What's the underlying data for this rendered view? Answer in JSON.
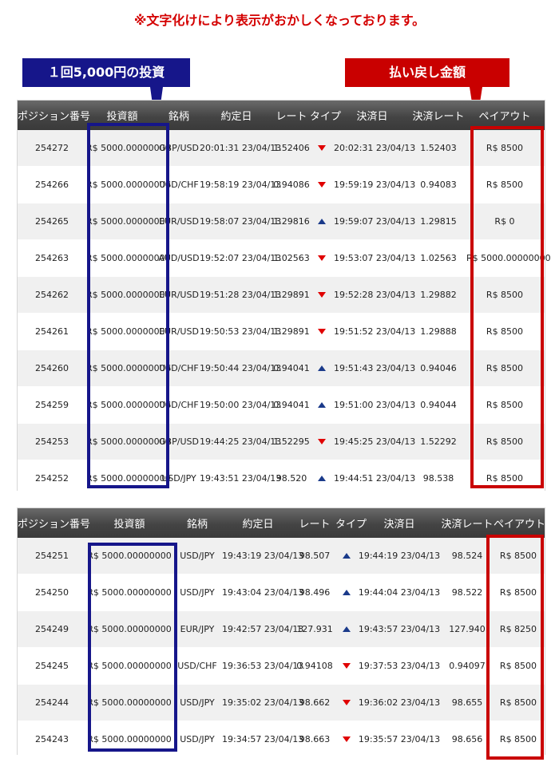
{
  "notice": "※文字化けにより表示がおかしくなっております。",
  "callouts": {
    "investment": "１回5,000円の投資",
    "payout": "払い戻し金額"
  },
  "columns": [
    "ポジション番号",
    "投資額",
    "銘柄",
    "約定日",
    "レート",
    "タイプ",
    "決済日",
    "決済レート",
    "ペイアウト"
  ],
  "colors": {
    "accent_blue": "#16168a",
    "accent_red": "#c90000",
    "down": "#e00000",
    "up": "#1a3a8a"
  },
  "table1": [
    {
      "id": "254272",
      "amount": "R$ 5000.00000000",
      "symbol": "GBP/USD",
      "date": "20:01:31 23/04/13",
      "rate": "1.52406",
      "type": "down",
      "settle_date": "20:02:31 23/04/13",
      "settle_rate": "1.52403",
      "payout": "R$ 8500"
    },
    {
      "id": "254266",
      "amount": "R$ 5000.00000000",
      "symbol": "USD/CHF",
      "date": "19:58:19 23/04/13",
      "rate": "0.94086",
      "type": "down",
      "settle_date": "19:59:19 23/04/13",
      "settle_rate": "0.94083",
      "payout": "R$ 8500"
    },
    {
      "id": "254265",
      "amount": "R$ 5000.00000000",
      "symbol": "EUR/USD",
      "date": "19:58:07 23/04/13",
      "rate": "1.29816",
      "type": "up",
      "settle_date": "19:59:07 23/04/13",
      "settle_rate": "1.29815",
      "payout": "R$ 0"
    },
    {
      "id": "254263",
      "amount": "R$ 5000.00000000",
      "symbol": "AUD/USD",
      "date": "19:52:07 23/04/13",
      "rate": "1.02563",
      "type": "down",
      "settle_date": "19:53:07 23/04/13",
      "settle_rate": "1.02563",
      "payout": "R$ 5000.00000000"
    },
    {
      "id": "254262",
      "amount": "R$ 5000.00000000",
      "symbol": "EUR/USD",
      "date": "19:51:28 23/04/13",
      "rate": "1.29891",
      "type": "down",
      "settle_date": "19:52:28 23/04/13",
      "settle_rate": "1.29882",
      "payout": "R$ 8500"
    },
    {
      "id": "254261",
      "amount": "R$ 5000.00000000",
      "symbol": "EUR/USD",
      "date": "19:50:53 23/04/13",
      "rate": "1.29891",
      "type": "down",
      "settle_date": "19:51:52 23/04/13",
      "settle_rate": "1.29888",
      "payout": "R$ 8500"
    },
    {
      "id": "254260",
      "amount": "R$ 5000.00000000",
      "symbol": "USD/CHF",
      "date": "19:50:44 23/04/13",
      "rate": "0.94041",
      "type": "up",
      "settle_date": "19:51:43 23/04/13",
      "settle_rate": "0.94046",
      "payout": "R$ 8500"
    },
    {
      "id": "254259",
      "amount": "R$ 5000.00000000",
      "symbol": "USD/CHF",
      "date": "19:50:00 23/04/13",
      "rate": "0.94041",
      "type": "up",
      "settle_date": "19:51:00 23/04/13",
      "settle_rate": "0.94044",
      "payout": "R$ 8500"
    },
    {
      "id": "254253",
      "amount": "R$ 5000.00000000",
      "symbol": "GBP/USD",
      "date": "19:44:25 23/04/13",
      "rate": "1.52295",
      "type": "down",
      "settle_date": "19:45:25 23/04/13",
      "settle_rate": "1.52292",
      "payout": "R$ 8500"
    },
    {
      "id": "254252",
      "amount": "R$ 5000.00000000",
      "symbol": "USD/JPY",
      "date": "19:43:51 23/04/13",
      "rate": "98.520",
      "type": "up",
      "settle_date": "19:44:51 23/04/13",
      "settle_rate": "98.538",
      "payout": "R$ 8500"
    }
  ],
  "table2": [
    {
      "id": "254251",
      "amount": "R$ 5000.00000000",
      "symbol": "USD/JPY",
      "date": "19:43:19 23/04/13",
      "rate": "98.507",
      "type": "up",
      "settle_date": "19:44:19 23/04/13",
      "settle_rate": "98.524",
      "payout": "R$ 8500"
    },
    {
      "id": "254250",
      "amount": "R$ 5000.00000000",
      "symbol": "USD/JPY",
      "date": "19:43:04 23/04/13",
      "rate": "98.496",
      "type": "up",
      "settle_date": "19:44:04 23/04/13",
      "settle_rate": "98.522",
      "payout": "R$ 8500"
    },
    {
      "id": "254249",
      "amount": "R$ 5000.00000000",
      "symbol": "EUR/JPY",
      "date": "19:42:57 23/04/13",
      "rate": "127.931",
      "type": "up",
      "settle_date": "19:43:57 23/04/13",
      "settle_rate": "127.940",
      "payout": "R$ 8250"
    },
    {
      "id": "254245",
      "amount": "R$ 5000.00000000",
      "symbol": "USD/CHF",
      "date": "19:36:53 23/04/13",
      "rate": "0.94108",
      "type": "down",
      "settle_date": "19:37:53 23/04/13",
      "settle_rate": "0.94097",
      "payout": "R$ 8500"
    },
    {
      "id": "254244",
      "amount": "R$ 5000.00000000",
      "symbol": "USD/JPY",
      "date": "19:35:02 23/04/13",
      "rate": "98.662",
      "type": "down",
      "settle_date": "19:36:02 23/04/13",
      "settle_rate": "98.655",
      "payout": "R$ 8500"
    },
    {
      "id": "254243",
      "amount": "R$ 5000.00000000",
      "symbol": "USD/JPY",
      "date": "19:34:57 23/04/13",
      "rate": "98.663",
      "type": "down",
      "settle_date": "19:35:57 23/04/13",
      "settle_rate": "98.656",
      "payout": "R$ 8500"
    }
  ]
}
